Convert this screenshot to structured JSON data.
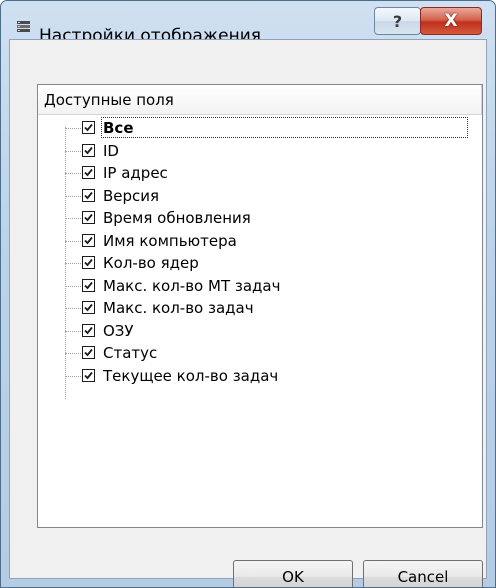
{
  "window": {
    "title": "Настройки отображения",
    "help_label": "?",
    "close_label": "X"
  },
  "panel": {
    "header": "Доступные поля",
    "items": [
      {
        "label": "Все",
        "checked": true,
        "bold": true
      },
      {
        "label": "ID",
        "checked": true
      },
      {
        "label": "IP адрес",
        "checked": true
      },
      {
        "label": "Версия",
        "checked": true
      },
      {
        "label": "Время обновления",
        "checked": true
      },
      {
        "label": "Имя компьютера",
        "checked": true
      },
      {
        "label": "Кол-во ядер",
        "checked": true
      },
      {
        "label": "Макс. кол-во МТ задач",
        "checked": true
      },
      {
        "label": "Макс. кол-во задач",
        "checked": true
      },
      {
        "label": "ОЗУ",
        "checked": true
      },
      {
        "label": "Статус",
        "checked": true
      },
      {
        "label": "Текущее кол-во задач",
        "checked": true
      }
    ]
  },
  "buttons": {
    "ok_label": "OK",
    "cancel_label": "Cancel"
  }
}
